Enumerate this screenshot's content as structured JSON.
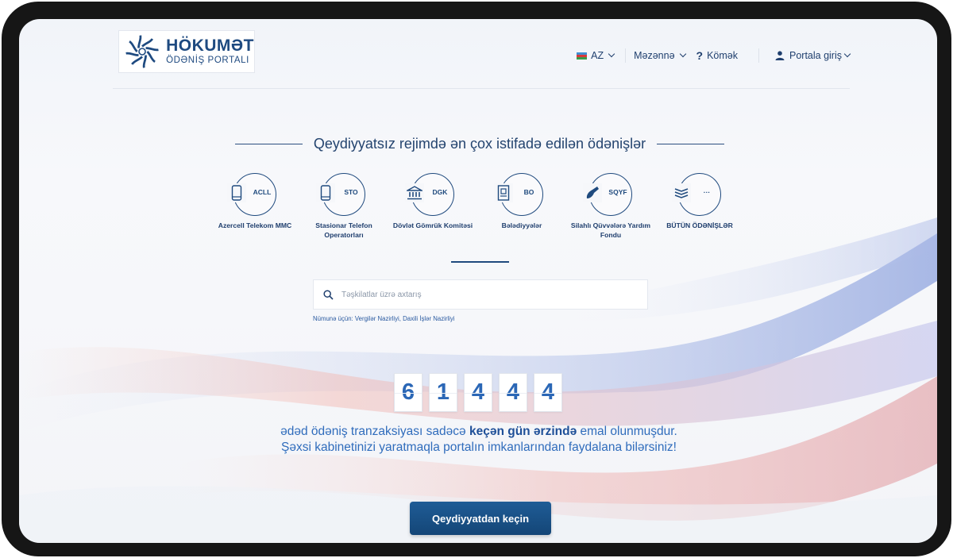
{
  "logo": {
    "title": "HÖKUMƏT",
    "subtitle": "ÖDƏNİŞ PORTALI"
  },
  "nav": {
    "language": "AZ",
    "currency": "Məzənnə",
    "help": "Kömək",
    "login": "Portala giriş"
  },
  "headline": "Qeydiyyatsız rejimdə ən çox istifadə edilən ödənişlər",
  "services": [
    {
      "code": "ACLL",
      "label": "Azercell Telekom MMC",
      "icon": "mobile-phone-icon"
    },
    {
      "code": "STO",
      "label": "Stasionar Telefon Operatorları",
      "icon": "phone-icon"
    },
    {
      "code": "DGK",
      "label": "Dövlət Gömrük Komitəsi",
      "icon": "government-building-icon"
    },
    {
      "code": "BO",
      "label": "Bələdiyyələr",
      "icon": "document-icon"
    },
    {
      "code": "SQYF",
      "label": "Silahlı Qüvvələrə Yardım Fondu",
      "icon": "hand-icon"
    },
    {
      "code": "···",
      "label": "BÜTÜN ÖDƏNİŞLƏR",
      "icon": "all-payments-icon"
    }
  ],
  "search": {
    "placeholder": "Təşkilatlar üzrə axtarış",
    "example": "Nümunə üçün: Vergilər Nazirliyi, Daxili İşlər Nazirliyi"
  },
  "counter": {
    "digits": [
      "6",
      "1",
      "4",
      "4",
      "4"
    ]
  },
  "message": {
    "part1": "ədəd ödəniş tranzaksiyası sadəcə ",
    "bold": "keçən gün ərzində",
    "part2": " emal olunmuşdur.",
    "line2": "Şəxsi kabinetinizi yaratmaqla portalın imkanlarından faydalana bilərsiniz!"
  },
  "cta": "Qeydiyyatdan keçin",
  "colors": {
    "brand": "#1f4a7e",
    "accent": "#2b67b6",
    "button": "#1a5088"
  }
}
